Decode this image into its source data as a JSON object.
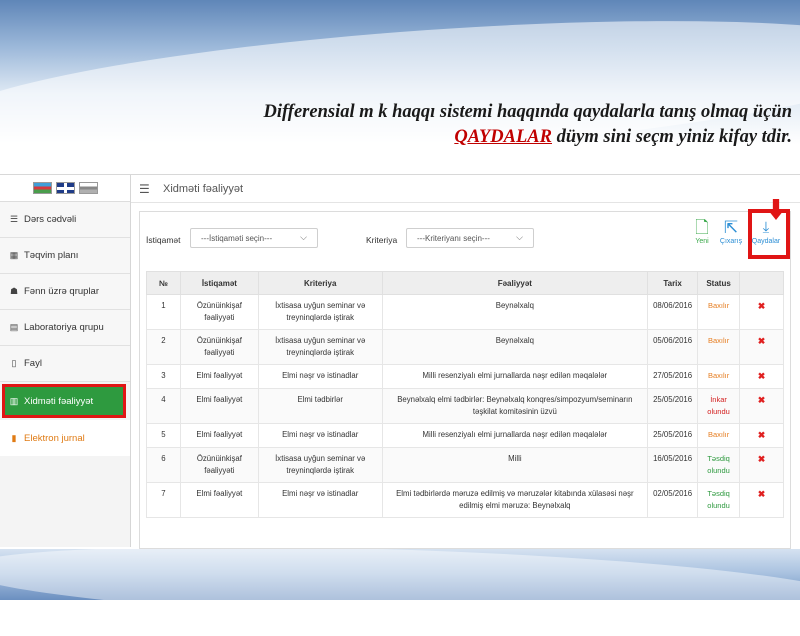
{
  "headline": {
    "line1": "Differensial    m   k haqqı sistemi haqqında qaydalarla tanış olmaq üçün",
    "keyword": "QAYDALAR",
    "line2": " düym    sini seçm    yiniz kifay    tdir."
  },
  "languages": [
    {
      "code": "az",
      "icon": "azerbaijan-flag-icon"
    },
    {
      "code": "en",
      "icon": "uk-flag-icon"
    },
    {
      "code": "ru",
      "icon": "russia-flag-icon"
    }
  ],
  "sidebar": {
    "items": [
      {
        "label": "Dərs cədvəli",
        "icon": "list-icon",
        "glyph": "☰"
      },
      {
        "label": "Təqvim planı",
        "icon": "calendar-icon",
        "glyph": "▦"
      },
      {
        "label": "Fənn üzrə qruplar",
        "icon": "users-icon",
        "glyph": "☗"
      },
      {
        "label": "Laboratoriya qrupu",
        "icon": "grid-icon",
        "glyph": "▤"
      },
      {
        "label": "Fayl",
        "icon": "file-icon",
        "glyph": "▯"
      },
      {
        "label": "Xidməti fəaliyyət",
        "icon": "chart-icon",
        "glyph": "▥",
        "active": true
      },
      {
        "label": "Elektron jurnal",
        "icon": "journal-icon",
        "glyph": "▮",
        "accent": "#e07b14"
      }
    ]
  },
  "topbar": {
    "title": "Xidməti fəaliyyət",
    "menu_icon": "hamburger-icon"
  },
  "filters": {
    "direction_label": "İstiqamət",
    "direction_placeholder": "---İstiqaməti seçin---",
    "criteria_label": "Kriteriya",
    "criteria_placeholder": "---Kriteriyanı seçin---"
  },
  "actions": {
    "new_label": "Yeni",
    "export_label": "Çıxarış",
    "rules_label": "Qaydalar"
  },
  "table": {
    "headers": [
      "№",
      "İstiqamət",
      "Kriteriya",
      "Fəaliyyət",
      "Tarix",
      "Status",
      ""
    ],
    "rows": [
      {
        "n": "1",
        "direction": "Özünüinkişaf fəaliyyəti",
        "criteria": "İxtisasa uyğun seminar və treyninqlərdə iştirak",
        "activity": "Beynəlxalq",
        "date": "08/06/2016",
        "status": "Baxılır",
        "status_color": "#e67e22"
      },
      {
        "n": "2",
        "direction": "Özünüinkişaf fəaliyyəti",
        "criteria": "İxtisasa uyğun seminar və treyninqlərdə iştirak",
        "activity": "Beynəlxalq",
        "date": "05/06/2016",
        "status": "Baxılır",
        "status_color": "#e67e22"
      },
      {
        "n": "3",
        "direction": "Elmi fəaliyyət",
        "criteria": "Elmi nəşr və istinadlar",
        "activity": "Milli resenziyalı elmi jurnallarda nəşr edilən məqalələr",
        "date": "27/05/2016",
        "status": "Baxılır",
        "status_color": "#e67e22"
      },
      {
        "n": "4",
        "direction": "Elmi fəaliyyət",
        "criteria": "Elmi tədbirlər",
        "activity": "Beynəlxalq elmi tədbirlər: Beynəlxalq konqres/simpozyum/seminarın təşkilat komitəsinin üzvü",
        "date": "25/05/2016",
        "status": "İnkar olundu",
        "status_color": "#d42020"
      },
      {
        "n": "5",
        "direction": "Elmi fəaliyyət",
        "criteria": "Elmi nəşr və istinadlar",
        "activity": "Milli resenziyalı elmi jurnallarda nəşr edilən məqalələr",
        "date": "25/05/2016",
        "status": "Baxılır",
        "status_color": "#e67e22"
      },
      {
        "n": "6",
        "direction": "Özünüinkişaf fəaliyyəti",
        "criteria": "İxtisasa uyğun seminar və treyninqlərdə iştirak",
        "activity": "Milli",
        "date": "16/05/2016",
        "status": "Təsdiq olundu",
        "status_color": "#2e9a3f"
      },
      {
        "n": "7",
        "direction": "Elmi fəaliyyət",
        "criteria": "Elmi nəşr və istinadlar",
        "activity": "Elmi tədbirlərdə məruzə edilmiş və məruzələr kitabında xülasəsi nəşr edilmiş elmi məruzə: Beynəlxalq",
        "date": "02/05/2016",
        "status": "Təsdiq olundu",
        "status_color": "#2e9a3f"
      }
    ]
  }
}
